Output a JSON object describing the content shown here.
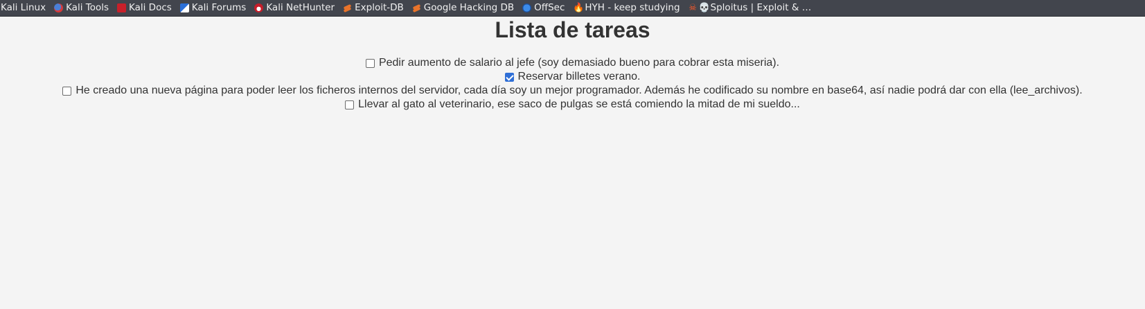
{
  "bookmarks": [
    {
      "label": "Kali Linux",
      "icon": "none"
    },
    {
      "label": "Kali Tools",
      "icon": "kali-tools-icon"
    },
    {
      "label": "Kali Docs",
      "icon": "kali-docs-icon"
    },
    {
      "label": "Kali Forums",
      "icon": "kali-forums-icon"
    },
    {
      "label": "Kali NetHunter",
      "icon": "kali-nethunter-icon"
    },
    {
      "label": "Exploit-DB",
      "icon": "exploit-db-icon"
    },
    {
      "label": "Google Hacking DB",
      "icon": "exploit-db-icon"
    },
    {
      "label": "OffSec",
      "icon": "offsec-icon"
    },
    {
      "label": "HYH - keep studying",
      "icon": "fire-icon"
    },
    {
      "label": "Sploitus | Exploit & …",
      "icon": "skull-icon"
    }
  ],
  "page": {
    "title": "Lista de tareas"
  },
  "tasks": [
    {
      "text": "Pedir aumento de salario al jefe (soy demasiado bueno para cobrar esta miseria).",
      "checked": false
    },
    {
      "text": "Reservar billetes verano.",
      "checked": true
    },
    {
      "text": "He creado una nueva página para poder leer los ficheros internos del servidor, cada día soy un mejor programador. Además he codificado su nombre en base64, así nadie podrá dar con ella (lee_archivos).",
      "checked": false
    },
    {
      "text": "Llevar al gato al veterinario, ese saco de pulgas se está comiendo la mitad de mi sueldo...",
      "checked": false
    }
  ],
  "colors": {
    "bookmarks_bar_bg": "#42454d",
    "page_bg": "#f4f4f4",
    "text": "#333333",
    "checkbox_checked": "#2f6fd6"
  }
}
